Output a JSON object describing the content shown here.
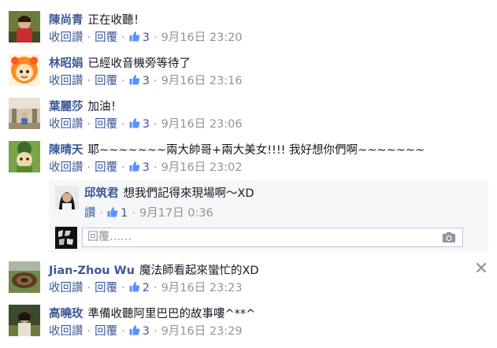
{
  "comments": [
    {
      "author": "陳尚青",
      "text": "正在收聽！",
      "unlike": "收回讚",
      "reply": "回覆",
      "likes": "3",
      "time": "9月16日 23:20"
    },
    {
      "author": "林昭娟",
      "text": "已經收音機旁等待了",
      "unlike": "收回讚",
      "reply": "回覆",
      "likes": "3",
      "time": "9月16日 23:16"
    },
    {
      "author": "葉麗莎",
      "text": "加油！",
      "unlike": "收回讚",
      "reply": "回覆",
      "likes": "3",
      "time": "9月16日 23:06"
    },
    {
      "author": "陳晴天",
      "text": "耶~~~~~~~兩大帥哥+兩大美女!!!! 我好想你們啊~~~~~~~",
      "unlike": "收回讚",
      "reply": "回覆",
      "likes": "3",
      "time": "9月16日 23:02"
    },
    {
      "author": "Jian-Zhou Wu",
      "text": "魔法師看起來蠻忙的XD",
      "unlike": "收回讚",
      "reply": "回覆",
      "likes": "2",
      "time": "9月16日 23:23"
    },
    {
      "author": "高曉玫",
      "text": "準備收聽阿里巴巴的故事嘍^**^",
      "unlike": "收回讚",
      "reply": "回覆",
      "likes": "3",
      "time": "9月16日 23:29"
    }
  ],
  "reply": {
    "author": "邱筑君",
    "text": "想我們記得來現場啊～XD",
    "like": "讚",
    "likes": "1",
    "time": "9月17日 0:36",
    "input_placeholder": "回覆……"
  },
  "colors": {
    "link": "#3b5998",
    "meta": "#90949c",
    "reply_bg": "#f6f7f9"
  }
}
